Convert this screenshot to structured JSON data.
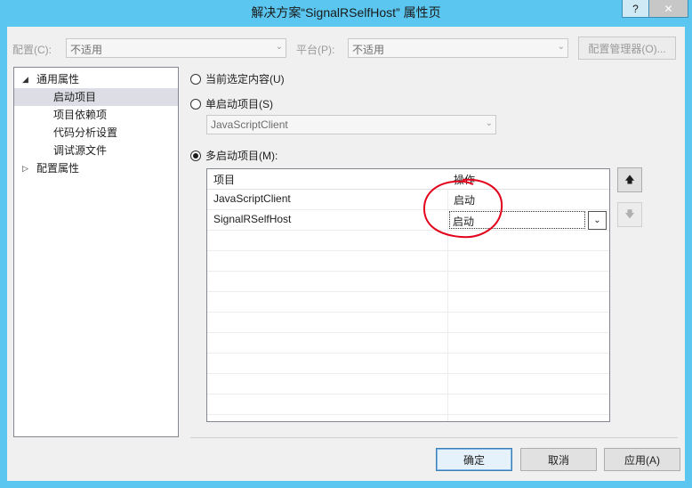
{
  "window": {
    "title": "解决方案“SignalRSelfHost” 属性页",
    "help_label": "?",
    "close_label": "✕"
  },
  "config_row": {
    "config_label": "配置(C):",
    "config_value": "不适用",
    "platform_label": "平台(P):",
    "platform_value": "不适用",
    "manager_button": "配置管理器(O)..."
  },
  "tree": {
    "items": [
      {
        "label": "通用属性",
        "expander": "◢"
      },
      {
        "label": "启动项目"
      },
      {
        "label": "项目依赖项"
      },
      {
        "label": "代码分析设置"
      },
      {
        "label": "调试源文件"
      },
      {
        "label": "配置属性",
        "expander": "▷"
      }
    ]
  },
  "options": {
    "current_selection": "当前选定内容(U)",
    "single_startup": "单启动项目(S)",
    "single_value": "JavaScriptClient",
    "multiple_startup": "多启动项目(M):"
  },
  "grid": {
    "headers": [
      "项目",
      "操作"
    ],
    "rows": [
      {
        "project": "JavaScriptClient",
        "action": "启动"
      },
      {
        "project": "SignalRSelfHost",
        "action": "启动"
      }
    ]
  },
  "side_buttons": {
    "up": "🡅",
    "down": "🡇"
  },
  "footer": {
    "ok": "确定",
    "cancel": "取消",
    "apply": "应用(A)"
  },
  "colors": {
    "title_bar": "#5bc6ef",
    "annotation": "#e3001b"
  }
}
